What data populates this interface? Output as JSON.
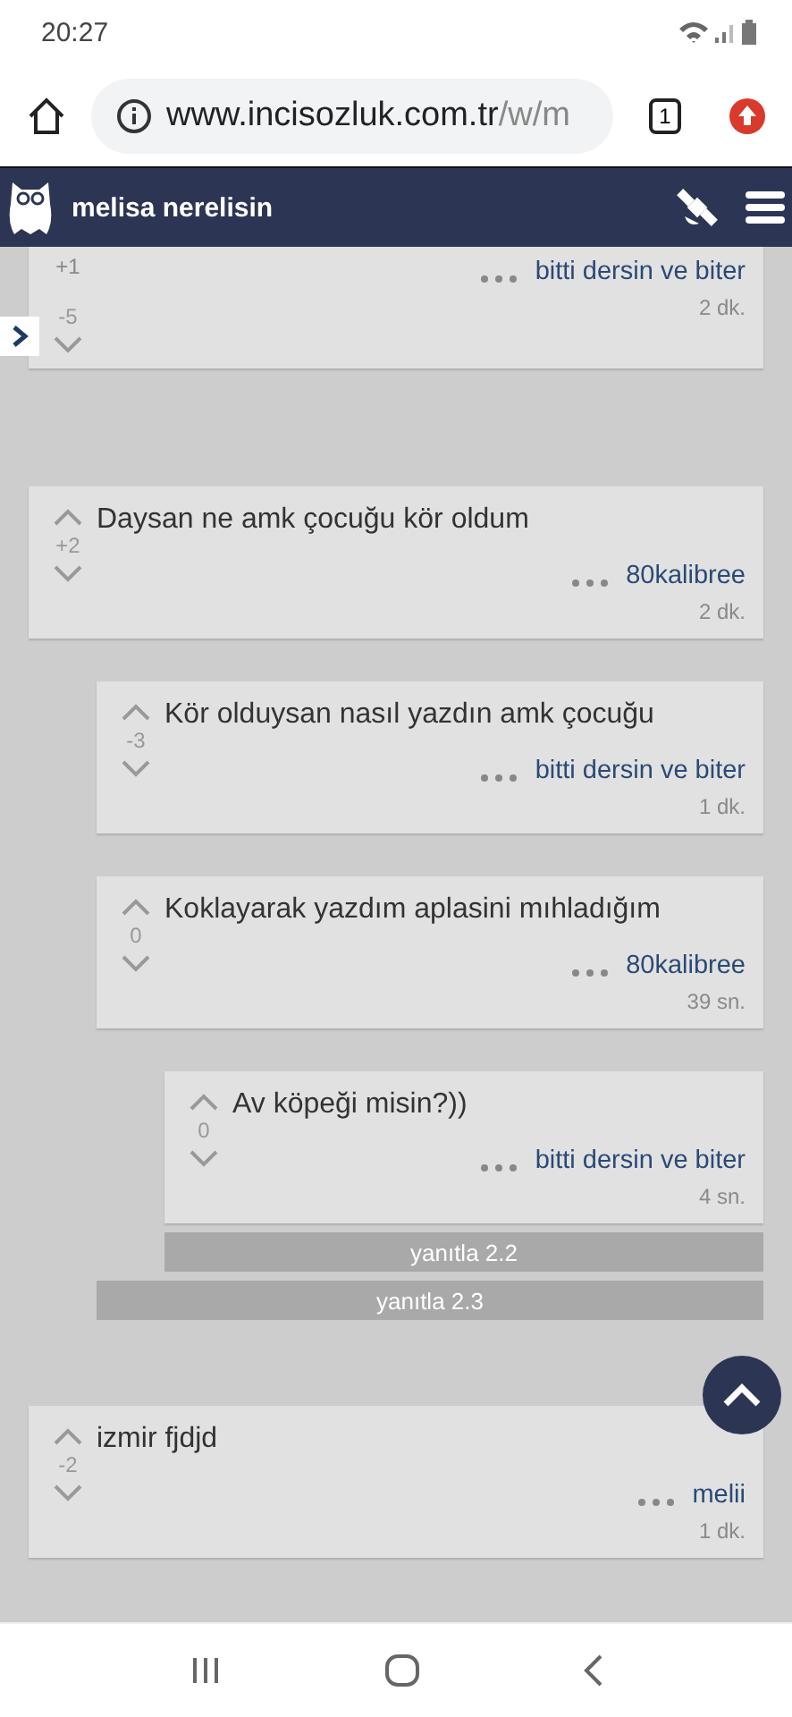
{
  "status_bar": {
    "time": "20:27"
  },
  "browser": {
    "url_host": "www.incisozluk.com.tr",
    "url_path": "/w/m",
    "tab_count": "1"
  },
  "header": {
    "title": "melisa nerelisin"
  },
  "entries": [
    {
      "kind": "cut",
      "extra": "+1",
      "score": "-5",
      "author": "bitti dersin ve biter",
      "time": "2 dk."
    },
    {
      "kind": "full",
      "text": "Daysan ne amk çocuğu kör oldum",
      "score": "+2",
      "author": "80kalibree",
      "time": "2 dk.",
      "reply": "yanıtla 2.3",
      "children": [
        {
          "kind": "full",
          "text": "Kör olduysan nasıl yazdın amk çocuğu",
          "score": "-3",
          "author": "bitti dersin ve biter",
          "time": "1 dk."
        },
        {
          "kind": "full",
          "text": "Koklayarak yazdım aplasini mıhladığım",
          "score": "0",
          "author": "80kalibree",
          "time": "39 sn.",
          "reply": "yanıtla 2.2",
          "children": [
            {
              "kind": "full",
              "text": "Av köpeği misin?))",
              "score": "0",
              "author": "bitti dersin ve biter",
              "time": "4 sn."
            }
          ]
        }
      ]
    },
    {
      "kind": "full",
      "text": "izmir fjdjd",
      "score": "-2",
      "author": "melii",
      "time": "1 dk."
    }
  ]
}
